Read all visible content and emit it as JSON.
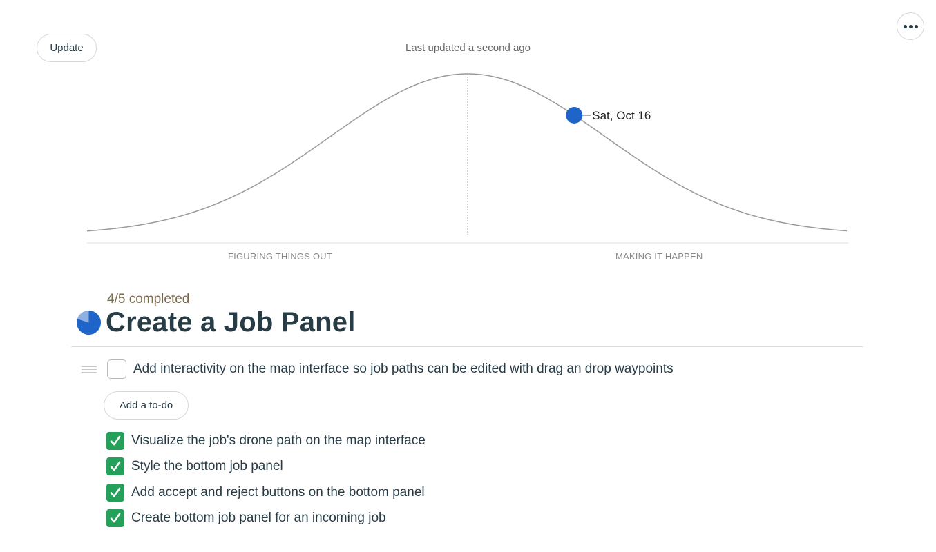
{
  "toolbar": {
    "update_label": "Update",
    "more_icon": "ellipsis-icon"
  },
  "status": {
    "last_updated_prefix": "Last updated",
    "last_updated_link": "a second ago"
  },
  "chart_data": {
    "type": "line",
    "series": [
      {
        "name": "",
        "shape": "hill-bell-curve"
      }
    ],
    "phases": [
      "FIGURING THINGS OUT",
      "MAKING IT HAPPEN"
    ],
    "points": [
      {
        "label": "Sat, Oct 16",
        "progress": 0.64,
        "color": "#1f64c8"
      }
    ],
    "grid": false
  },
  "list": {
    "progress_text": "4/5 completed",
    "completed": 4,
    "total": 5,
    "title": "Create a Job Panel",
    "add_todo_label": "Add a to-do",
    "open_items": [
      {
        "text": "Add interactivity on the map interface so job paths can be edited with drag an drop waypoints",
        "checked": false
      }
    ],
    "completed_items": [
      {
        "text": "Visualize the job's drone path on the map interface",
        "checked": true
      },
      {
        "text": "Style the bottom job panel",
        "checked": true
      },
      {
        "text": "Add accept and reject buttons on the bottom panel",
        "checked": true
      },
      {
        "text": "Create bottom job panel for an incoming job",
        "checked": true
      }
    ]
  },
  "colors": {
    "accent": "#1f64c8",
    "check_green": "#24a05a",
    "title": "#283c46",
    "progress_text": "#7a6a4e"
  }
}
